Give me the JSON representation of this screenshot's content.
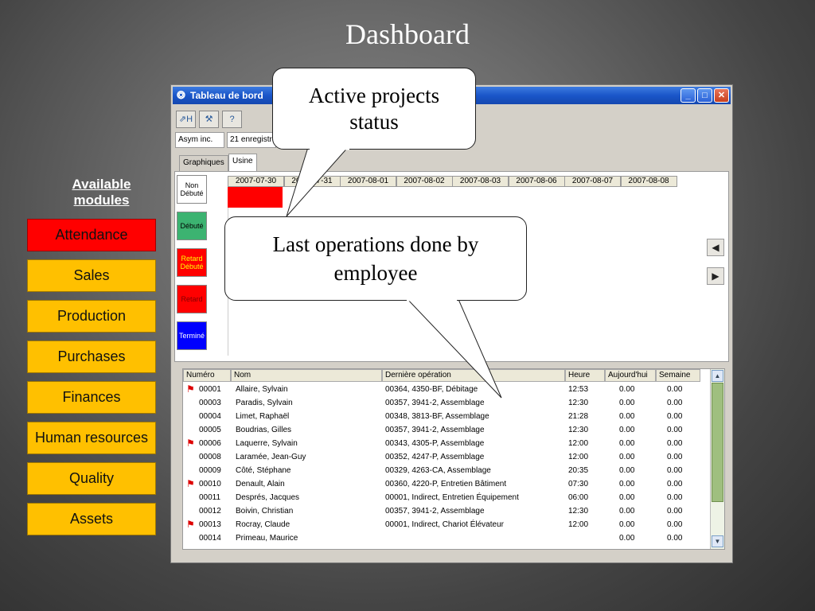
{
  "slide": {
    "title": "Dashboard",
    "modules_heading": "Available modules",
    "modules": [
      "Attendance",
      "Sales",
      "Production",
      "Purchases",
      "Finances",
      "Human resources",
      "Quality",
      "Assets"
    ]
  },
  "window": {
    "title": "Tableau de bord",
    "toolbar": [
      "chart-H-icon",
      "worker-icon",
      "help-icon"
    ],
    "company": "Asym inc.",
    "records": "21 enregistrements",
    "tabs": [
      "Graphiques",
      "Usine"
    ],
    "legend": [
      {
        "label": "Non Débuté",
        "color": "#ffffff",
        "text_color": "#000000"
      },
      {
        "label": "Débuté",
        "color": "#3cb371",
        "text_color": "#000000"
      },
      {
        "label": "Retard Débuté",
        "color": "#ff0000",
        "text_color": "#ffff00"
      },
      {
        "label": "Retard",
        "color": "#ff0000",
        "text_color": "#800000"
      },
      {
        "label": "Terminé",
        "color": "#0000ff",
        "text_color": "#ffffff"
      }
    ],
    "dates": [
      "2007-07-30",
      "2007-07-31",
      "2007-08-01",
      "2007-08-02",
      "2007-08-03",
      "2007-08-06",
      "2007-08-07",
      "2007-08-08"
    ],
    "columns": [
      "Numéro",
      "Nom",
      "Dernière opération",
      "Heure",
      "Aujourd'hui",
      "Semaine"
    ],
    "rows": [
      {
        "flag": true,
        "num": "00001",
        "nom": "Allaire, Sylvain",
        "op": "00364, 4350-BF, Débitage",
        "heure": "12:53",
        "auj": "0.00",
        "sem": "0.00"
      },
      {
        "flag": false,
        "num": "00003",
        "nom": "Paradis, Sylvain",
        "op": "00357, 3941-2, Assemblage",
        "heure": "12:30",
        "auj": "0.00",
        "sem": "0.00"
      },
      {
        "flag": false,
        "num": "00004",
        "nom": "Limet, Raphaël",
        "op": "00348, 3813-BF, Assemblage",
        "heure": "21:28",
        "auj": "0.00",
        "sem": "0.00"
      },
      {
        "flag": false,
        "num": "00005",
        "nom": "Boudrias, Gilles",
        "op": "00357, 3941-2, Assemblage",
        "heure": "12:30",
        "auj": "0.00",
        "sem": "0.00"
      },
      {
        "flag": true,
        "num": "00006",
        "nom": "Laquerre, Sylvain",
        "op": "00343, 4305-P, Assemblage",
        "heure": "12:00",
        "auj": "0.00",
        "sem": "0.00"
      },
      {
        "flag": false,
        "num": "00008",
        "nom": "Laramée, Jean-Guy",
        "op": "00352, 4247-P, Assemblage",
        "heure": "12:00",
        "auj": "0.00",
        "sem": "0.00"
      },
      {
        "flag": false,
        "num": "00009",
        "nom": "Côté, Stéphane",
        "op": "00329, 4263-CA, Assemblage",
        "heure": "20:35",
        "auj": "0.00",
        "sem": "0.00"
      },
      {
        "flag": true,
        "num": "00010",
        "nom": "Denault, Alain",
        "op": "00360, 4220-P, Entretien Bâtiment",
        "heure": "07:30",
        "auj": "0.00",
        "sem": "0.00"
      },
      {
        "flag": false,
        "num": "00011",
        "nom": "Després, Jacques",
        "op": "00001, Indirect, Entretien Équipement",
        "heure": "06:00",
        "auj": "0.00",
        "sem": "0.00"
      },
      {
        "flag": false,
        "num": "00012",
        "nom": "Boivin, Christian",
        "op": "00357, 3941-2, Assemblage",
        "heure": "12:30",
        "auj": "0.00",
        "sem": "0.00"
      },
      {
        "flag": true,
        "num": "00013",
        "nom": "Rocray, Claude",
        "op": "00001, Indirect, Chariot Élévateur",
        "heure": "12:00",
        "auj": "0.00",
        "sem": "0.00"
      },
      {
        "flag": false,
        "num": "00014",
        "nom": "Primeau, Maurice",
        "op": "",
        "heure": "",
        "auj": "0.00",
        "sem": "0.00"
      }
    ]
  },
  "callouts": {
    "active_projects": "Active projects status",
    "last_operations": "Last operations done by employee"
  }
}
